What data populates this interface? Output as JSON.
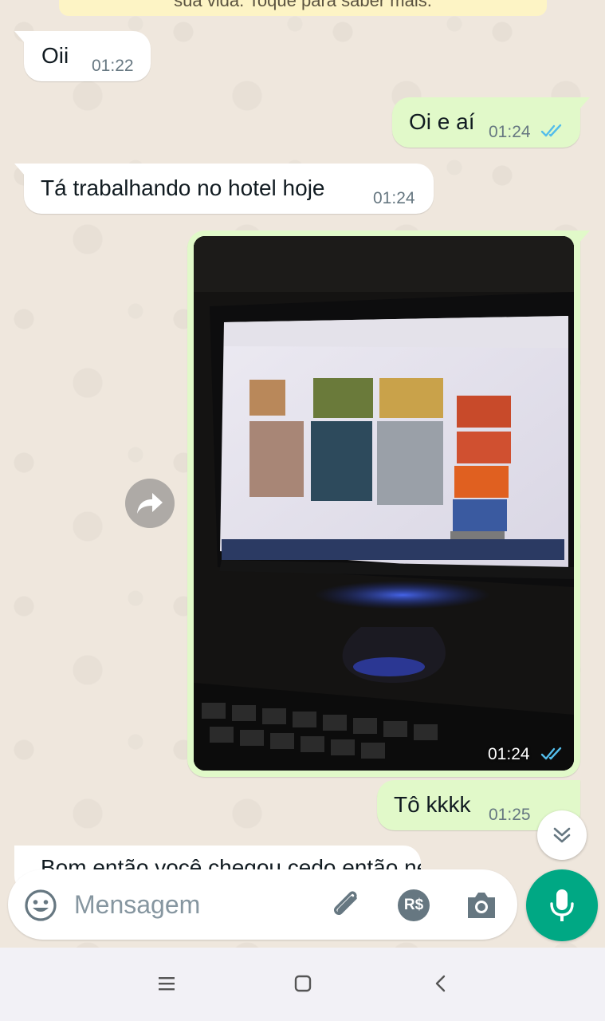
{
  "banner": {
    "text": "sua vida. Toque para saber mais."
  },
  "messages": [
    {
      "direction": "in",
      "text": "Oii",
      "time": "01:22"
    },
    {
      "direction": "out",
      "text": "Oi e aí",
      "time": "01:24",
      "status": "read"
    },
    {
      "direction": "in",
      "text": "Tá trabalhando no hotel hoje",
      "time": "01:24"
    },
    {
      "direction": "out",
      "type": "image",
      "time": "01:24",
      "status": "read"
    },
    {
      "direction": "out",
      "text": "Tô kkkk",
      "time": "01:25",
      "status": "read"
    },
    {
      "direction": "in",
      "text": "Bom então você chegou cedo então né",
      "partial": true
    }
  ],
  "composer": {
    "placeholder": "Mensagem",
    "icons": [
      "emoji-icon",
      "attach-icon",
      "payment-icon",
      "camera-icon",
      "mic-icon"
    ],
    "payment_label": "R$"
  },
  "colors": {
    "wallpaper": "#efe7dd",
    "outgoing_bubble": "#e1f9c9",
    "incoming_bubble": "#ffffff",
    "read_ticks": "#53bdeb",
    "accent": "#00a884"
  },
  "nav": {
    "icons": [
      "recent-apps-icon",
      "home-icon",
      "back-icon"
    ]
  }
}
